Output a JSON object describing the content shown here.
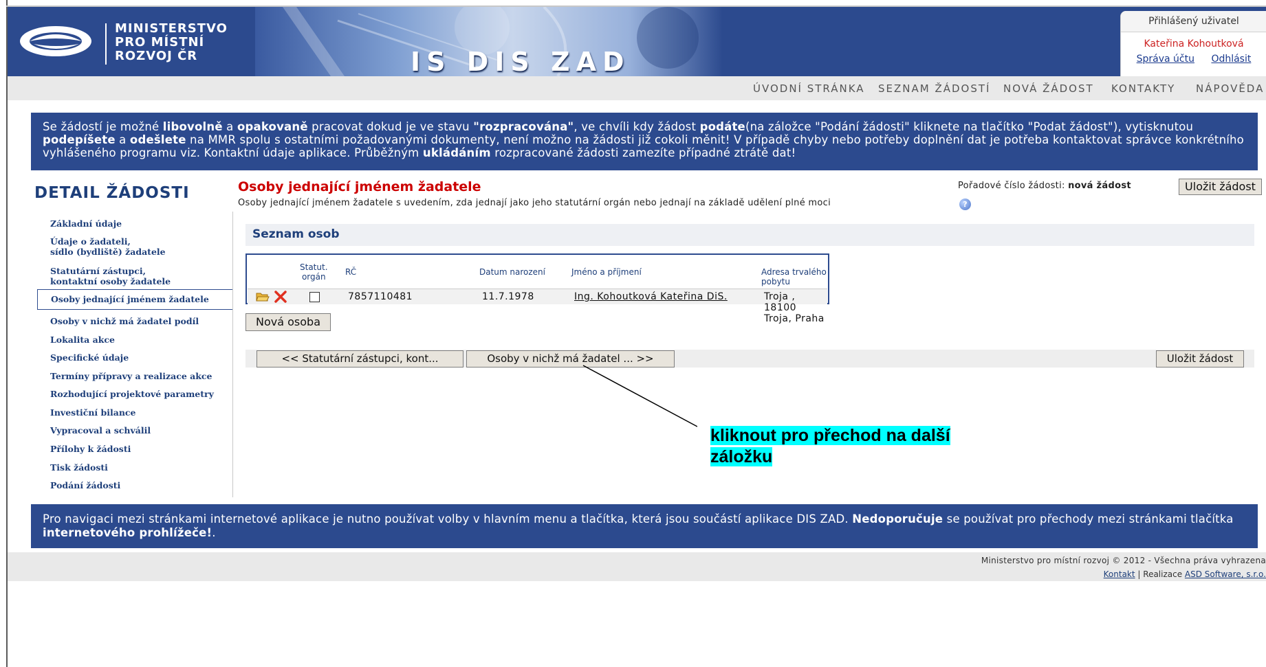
{
  "header": {
    "ministry_line1": "MINISTERSTVO",
    "ministry_line2": "PRO MÍSTNÍ",
    "ministry_line3": "ROZVOJ ČR",
    "app_title": "IS DIS ZAD",
    "logo_icon": "ministry-logo-icon",
    "brand_color": "#2c4a8e"
  },
  "user": {
    "heading": "Přihlášený uživatel",
    "name": "Kateřina Kohoutková",
    "account_link": "Správa účtu",
    "logout_link": "Odhlásit"
  },
  "topnav": {
    "home": "ÚVODNÍ STRÁNKA",
    "list": "SEZNAM ŽÁDOSTÍ",
    "new": "NOVÁ ŽÁDOST",
    "contacts": "KONTAKTY",
    "help": "NÁPOVĚDA"
  },
  "info": {
    "p1": "Se žádostí je možné ",
    "b1": "libovolně",
    "p2": " a ",
    "b2": "opakovaně",
    "p3": " pracovat dokud je ve stavu ",
    "b3": "\"rozpracována\"",
    "p4": ", ve chvíli kdy žádost ",
    "b4": "podáte",
    "p5": "(na záložce \"Podání žádosti\" kliknete na tlačítko \"Podat žádost\"), vytisknutou ",
    "b5": "podepíšete",
    "p6": " a ",
    "b6": "odešlete",
    "p7": " na MMR spolu s ostatními požadovanými dokumenty, není možno na žádosti již cokoli měnit! V případě chyby nebo potřeby doplnění dat je potřeba kontaktovat správce konkrétního vyhlášeného programu viz. Kontaktní údaje aplikace. Průběžným ",
    "b7": "ukládáním",
    "p8": " rozpracované žádosti zamezíte případné ztrátě dat!"
  },
  "sidebar": {
    "title": "DETAIL ŽÁDOSTI",
    "items": [
      {
        "label": "Základní údaje"
      },
      {
        "label": "Údaje o žadateli,",
        "label2": "sídlo (bydliště) žadatele"
      },
      {
        "label": "Statutární zástupci,",
        "label2": "kontaktní osoby žadatele"
      },
      {
        "label": "Osoby jednající jménem žadatele"
      },
      {
        "label": "Osoby v nichž má žadatel podíl"
      },
      {
        "label": "Lokalita akce"
      },
      {
        "label": "Specifické údaje"
      },
      {
        "label": "Termíny přípravy a realizace akce"
      },
      {
        "label": "Rozhodující projektové parametry"
      },
      {
        "label": "Investiční bilance"
      },
      {
        "label": "Vypracoval a schválil"
      },
      {
        "label": "Přílohy k žádosti"
      },
      {
        "label": "Tisk žádosti"
      },
      {
        "label": "Podání žádosti"
      }
    ]
  },
  "main": {
    "title": "Osoby jednající jménem žadatele",
    "description": "Osoby jednající jménem žadatele s uvedením, zda jednají jako jeho statutární orgán nebo jednají na základě udělení plné moci",
    "order_label": "Pořadové číslo žádosti: ",
    "order_value": "nová žádost",
    "save_label": "Uložit žádost",
    "section_title": "Seznam osob",
    "table": {
      "headers": {
        "statut1": "Statut.",
        "statut2": "orgán",
        "rc": "RČ",
        "birth": "Datum narození",
        "name": "Jméno a příjmení",
        "address": "Adresa trvalého pobytu"
      },
      "rows": [
        {
          "rc": "7857110481",
          "birth": "11.7.1978",
          "name": "Ing. Kohoutková Kateřina DiS.",
          "address": "Troja , 18100 Troja, Praha"
        }
      ]
    },
    "new_person_label": "Nová osoba",
    "prev_label": "<<  Statutární zástupci, kont...",
    "next_label": "Osoby v nichž má žadatel ...  >>"
  },
  "callout": {
    "line1": "kliknout pro přechod na další",
    "line2": "záložku",
    "highlight_color": "#00ffff"
  },
  "footinfo": {
    "p1": "Pro navigaci mezi stránkami internetové aplikace je nutno používat volby v hlavním menu a tlačítka, která jsou součástí aplikace DIS ZAD. ",
    "b1": "Nedoporučuje",
    "p2": " se používat pro přechody mezi stránkami tlačítka ",
    "b2": "internetového prohlížeče!",
    "p3": "."
  },
  "footer": {
    "copyright": "Ministerstvo pro místní rozvoj © 2012 - Všechna práva vyhrazena",
    "contact_link": "Kontakt",
    "separator": " | Realizace ",
    "vendor_link": "ASD Software, s.r.o."
  }
}
